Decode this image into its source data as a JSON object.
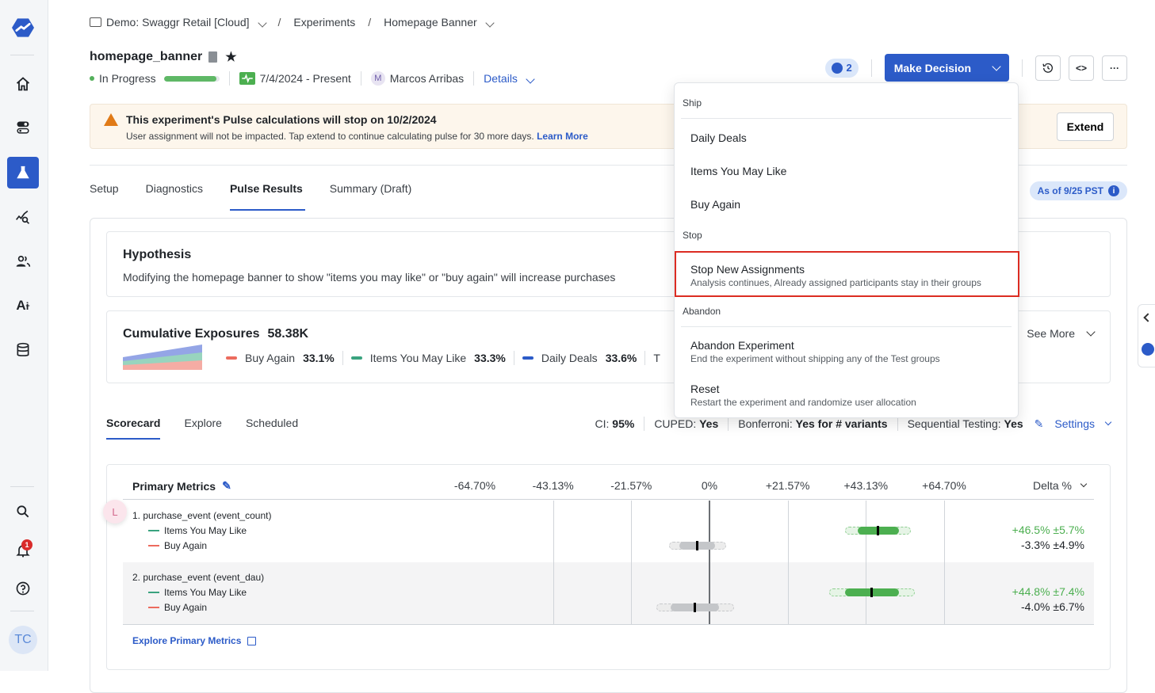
{
  "sidebar": {
    "logo": "statsig-logo-icon",
    "items": [
      {
        "name": "home",
        "icon": "home-icon"
      },
      {
        "name": "feature-gates",
        "icon": "toggle-icon"
      },
      {
        "name": "experiments",
        "icon": "flask-icon",
        "active": true
      },
      {
        "name": "analytics",
        "icon": "chart-search-icon"
      },
      {
        "name": "users",
        "icon": "users-icon"
      },
      {
        "name": "ai",
        "icon": "ai-sparkle-icon"
      },
      {
        "name": "data",
        "icon": "database-icon"
      }
    ],
    "bottom": [
      {
        "name": "search",
        "icon": "search-icon"
      },
      {
        "name": "notifications",
        "icon": "bell-icon",
        "badge": "1"
      },
      {
        "name": "help",
        "icon": "help-icon"
      }
    ],
    "avatar": "TC"
  },
  "breadcrumb": {
    "project": "Demo: Swaggr Retail [Cloud]",
    "section": "Experiments",
    "page": "Homepage Banner"
  },
  "header": {
    "title": "homepage_banner",
    "status": "In Progress",
    "progress": 0.95,
    "date_range": "7/4/2024 - Present",
    "owner_initial": "M",
    "owner": "Marcos Arribas",
    "details_label": "Details",
    "reviewers_count": "2",
    "make_decision_label": "Make Decision",
    "more_label": "···"
  },
  "banner": {
    "title": "This experiment's Pulse calculations will stop on 10/2/2024",
    "body": "User assignment will not be impacted. Tap extend to continue calculating pulse for 30 more days.",
    "link": "Learn More",
    "extend_label": "Extend"
  },
  "tabs": [
    {
      "label": "Setup"
    },
    {
      "label": "Diagnostics"
    },
    {
      "label": "Pulse Results",
      "active": true
    },
    {
      "label": "Summary (Draft)"
    }
  ],
  "as_of": "As of 9/25 PST",
  "hypothesis": {
    "title": "Hypothesis",
    "text": "Modifying the homepage banner to show \"items you may like\" or \"buy again\" will increase purchases"
  },
  "exposures": {
    "title": "Cumulative Exposures",
    "total": "58.38K",
    "groups": [
      {
        "name": "Buy Again",
        "pct": "33.1%",
        "color": "#ec6b5e"
      },
      {
        "name": "Items You May Like",
        "pct": "33.3%",
        "color": "#3aa37f"
      },
      {
        "name": "Daily Deals",
        "pct": "33.6%",
        "color": "#2c5bc8"
      }
    ],
    "truncated": "T",
    "see_more": "See More"
  },
  "subtabs": [
    {
      "label": "Scorecard",
      "active": true
    },
    {
      "label": "Explore"
    },
    {
      "label": "Scheduled"
    }
  ],
  "options": {
    "ci_label": "CI:",
    "ci": "95%",
    "cuped_label": "CUPED:",
    "cuped": "Yes",
    "bonf_label": "Bonferroni:",
    "bonf": "Yes for # variants",
    "seq_label": "Sequential Testing:",
    "seq": "Yes",
    "settings": "Settings"
  },
  "scorecard": {
    "title": "Primary Metrics",
    "delta_label": "Delta %",
    "ticks": [
      "-64.70%",
      "-43.13%",
      "-21.57%",
      "0%",
      "+21.57%",
      "+43.13%",
      "+64.70%"
    ],
    "tick_values": [
      -64.7,
      -43.13,
      -21.57,
      0,
      21.57,
      43.13,
      64.7
    ],
    "metrics": [
      {
        "name": "1. purchase_event (event_count)",
        "variants": [
          {
            "name": "Items You May Like",
            "color": "#3aa37f",
            "delta": 46.5,
            "ci": 5.7,
            "label": "+46.5% ±5.7%",
            "positive": true
          },
          {
            "name": "Buy Again",
            "color": "#ec6b5e",
            "delta": -3.3,
            "ci": 4.9,
            "label": "-3.3% ±4.9%",
            "positive": false
          }
        ]
      },
      {
        "name": "2. purchase_event (event_dau)",
        "variants": [
          {
            "name": "Items You May Like",
            "color": "#3aa37f",
            "delta": 44.8,
            "ci": 7.4,
            "label": "+44.8% ±7.4%",
            "positive": true
          },
          {
            "name": "Buy Again",
            "color": "#ec6b5e",
            "delta": -4.0,
            "ci": 6.7,
            "label": "-4.0% ±6.7%",
            "positive": false
          }
        ]
      }
    ],
    "explore_link": "Explore Primary Metrics"
  },
  "comment_initial": "L",
  "dropdown": {
    "sections": [
      {
        "title": "Ship",
        "items": [
          {
            "label": "Daily Deals"
          },
          {
            "label": "Items You May Like"
          },
          {
            "label": "Buy Again"
          }
        ]
      },
      {
        "title": "Stop",
        "items": [
          {
            "label": "Stop New Assignments",
            "sub": "Analysis continues, Already assigned participants stay in their groups",
            "highlighted": true
          }
        ]
      },
      {
        "title": "Abandon",
        "items": [
          {
            "label": "Abandon Experiment",
            "sub": "End the experiment without shipping any of the Test groups"
          },
          {
            "label": "Reset",
            "sub": "Restart the experiment and randomize user allocation"
          }
        ]
      }
    ]
  }
}
